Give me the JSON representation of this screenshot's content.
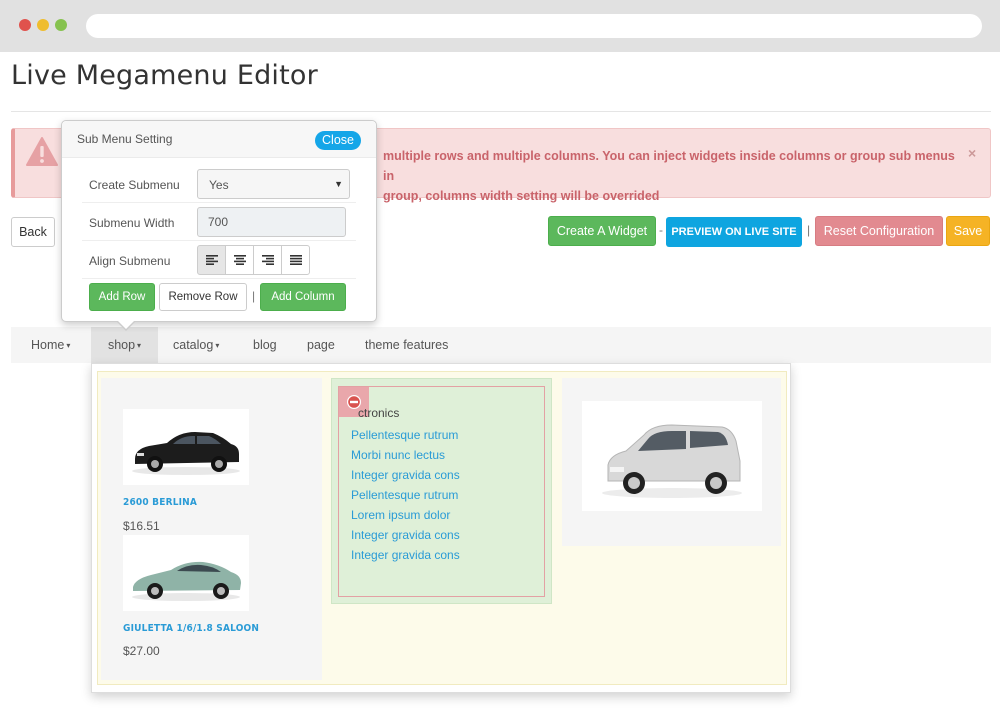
{
  "page": {
    "title": "Live Megamenu Editor"
  },
  "alert": {
    "text_line1": "multiple rows and multiple columns. You can inject widgets inside columns or group sub menus in",
    "text_line2": "group, columns width setting will be overrided",
    "close": "×",
    "icon": "warning-icon"
  },
  "toolbar": {
    "back": "Back",
    "create_widget": "Create A Widget",
    "sep1": "-",
    "preview": "PREVIEW ON LIVE SITE",
    "sep2": "|",
    "reset": "Reset Configuration",
    "save": "Save"
  },
  "popover": {
    "title": "Sub Menu Setting",
    "close": "Close",
    "create_submenu_label": "Create Submenu",
    "create_submenu_value": "Yes",
    "submenu_width_label": "Submenu Width",
    "submenu_width_value": "700",
    "align_submenu_label": "Align Submenu",
    "align_options": [
      "align-left-icon",
      "align-center-icon",
      "align-right-icon",
      "align-justify-icon"
    ],
    "add_row": "Add Row",
    "remove_row": "Remove Row",
    "sep": "|",
    "add_column": "Add Column"
  },
  "nav": {
    "items": [
      {
        "label": "Home",
        "caret": "▾"
      },
      {
        "label": "shop",
        "caret": "▾"
      },
      {
        "label": "catalog",
        "caret": "▾"
      },
      {
        "label": "blog"
      },
      {
        "label": "page"
      },
      {
        "label": "theme features"
      }
    ]
  },
  "megamenu": {
    "products": [
      {
        "name": "2600 BERLINA",
        "price": "$16.51"
      },
      {
        "name": "GIULETTA 1/6/1.8 SALOON",
        "price": "$27.00"
      }
    ],
    "category": {
      "heading": "ctronics",
      "links": [
        "Pellentesque rutrum",
        "Morbi nunc lectus",
        "Integer gravida cons",
        "Pellentesque rutrum",
        "Lorem ipsum dolor",
        "Integer gravida cons",
        "Integer gravida cons"
      ]
    }
  },
  "colors": {
    "success": "#5cb85c",
    "info": "#0ea5e0",
    "danger_soft": "#e28a90",
    "warning": "#f5b325",
    "link": "#2a9bd6"
  }
}
